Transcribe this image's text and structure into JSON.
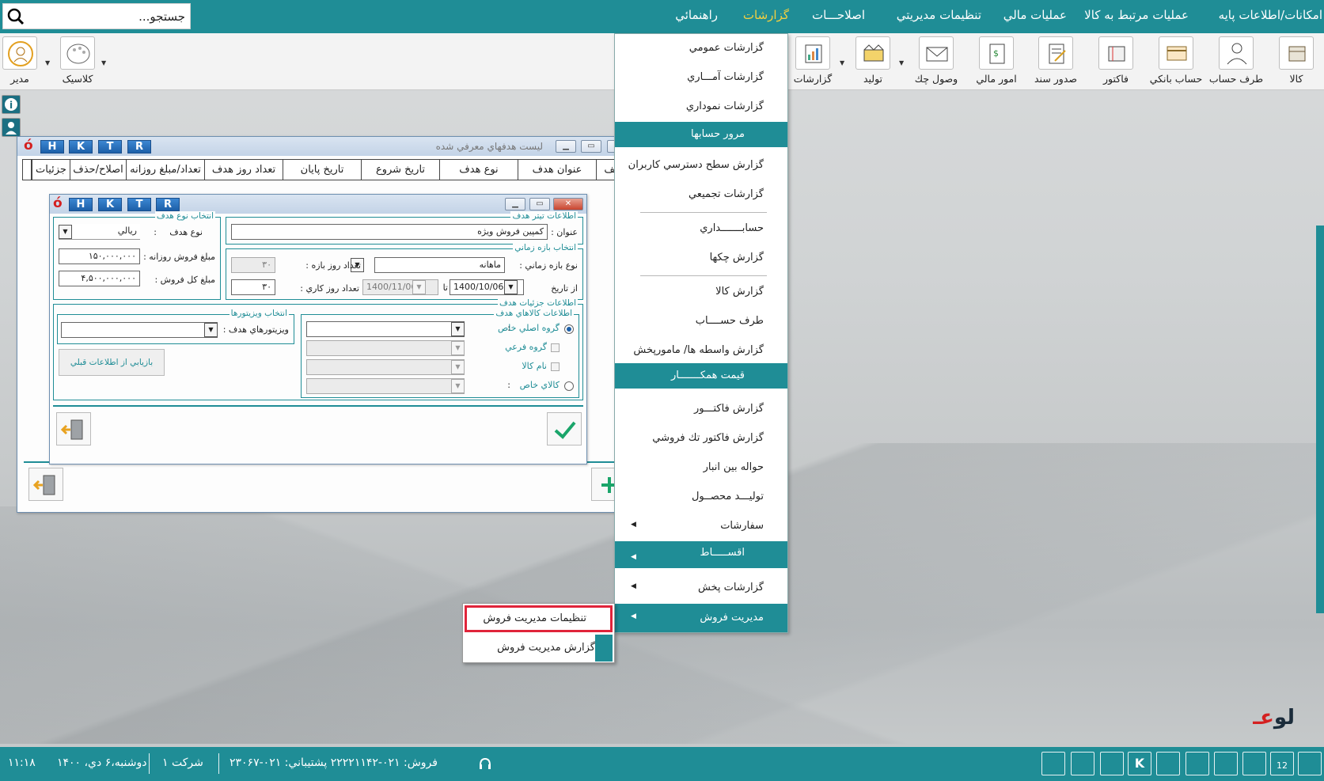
{
  "search": {
    "placeholder": "جستجو..."
  },
  "menubar": {
    "items": [
      "امکانات/اطلاعات پایه",
      "عملیات مرتبط به کالا",
      "عملیات مالي",
      "تنظيمات مديريتي",
      "اصلاحـــات",
      "گزارشات",
      "راهنمائي"
    ],
    "active": "گزارشات"
  },
  "toolbar": {
    "right": [
      "کالا",
      "طرف حساب",
      "حساب بانکي",
      "فاکتور",
      "صدور سند",
      "امور مالي",
      "وصول چك",
      "توليد",
      "گزارشات"
    ],
    "left": [
      "کلاسيک",
      "مدير"
    ]
  },
  "report_menu": {
    "items": [
      "گزارشات عمومي",
      "گزارشات آمـــاري",
      "گزارشات نموداري",
      "مرور حسابها",
      "گزارش سطح دسترسي کاربران",
      "گزارشات تجميعي",
      "حسابـــــــداري",
      "گزارش چکها",
      "گزارش کالا",
      "طرف حســــاب",
      "گزارش واسطه ها/ مامورپخش",
      "قيمت همکـــــــار",
      "گزارش فاکتـــور",
      "گزارش فاکتور تك فروشي",
      "حواله بين انبار",
      "توليـــد محصــول",
      "سفارشات",
      "اقســـــاط",
      "گزارشات پخش",
      "مديريت فروش"
    ]
  },
  "sub_menu": {
    "items": [
      "تنظيمات مديريت فروش",
      "گزارش مديريت فروش"
    ]
  },
  "list_window": {
    "title": "ليست هدفهاي معرفي شده",
    "letters": [
      "H",
      "K",
      "T",
      "R"
    ],
    "columns": [
      "رديف",
      "عنوان هدف",
      "نوع هدف",
      "تاريخ شروع",
      "تاريخ پايان",
      "تعداد روز هدف",
      "تعداد/مبلغ روزانه",
      "اصلاح/حذف",
      "جزئيات"
    ]
  },
  "form_window": {
    "letters": [
      "H",
      "K",
      "T",
      "R"
    ],
    "header_section": {
      "legend": "اطلاعات تيتر هدف",
      "title_label": "عنوان :",
      "title_value": "کمپين فروش ويژه"
    },
    "period_section": {
      "legend": "انتخاب بازه زماني",
      "type_label": "نوع بازه زماني :",
      "type_value": "ماهانه",
      "days_label": "تعداد روز بازه :",
      "days_value": "۳۰",
      "from_label": "از تاريخ",
      "from_value": "1400/10/06",
      "to_label": "تا",
      "to_value": "1400/11/06",
      "workdays_label": "تعداد روز کاري :",
      "workdays_value": "۳۰"
    },
    "goal_type_section": {
      "legend": "انتخاب نوع هدف",
      "type_label": "نوع هدف",
      "type_value": "ريالي",
      "daily_label": "مبلغ فروش روزانه :",
      "daily_value": "۱۵۰,۰۰۰,۰۰۰",
      "total_label": "مبلغ کل فروش :",
      "total_value": "۴,۵۰۰,۰۰۰,۰۰۰"
    },
    "details_section": {
      "legend": "اطلاعات جزئيات هدف",
      "goods_legend": "اطلاعات کالاهاي هدف",
      "options": [
        "گروه اصلي خاص",
        "گروه فرعي",
        "نام کالا",
        "کالاي خاص"
      ]
    },
    "visitor_section": {
      "legend": "انتخاب ويزيتورها",
      "label": "ويزيتورهاي هدف :",
      "restore_button": "بازيابي از اطلاعات قبلي"
    }
  },
  "statusbar": {
    "time": "۱۱:۱۸",
    "date": "دوشنبه،۶ دي، ۱۴۰۰",
    "company": "شرکت ۱",
    "contact": "فروش: ۰۲۱-۲۲۲۲۱۱۴۲  پشتيباني: ۰۲۱-۲۳۰۶۷"
  },
  "brand": {
    "name": "لو",
    "o": "عـ"
  },
  "colors": {
    "teal": "#1f8d96",
    "highlight": "#e0243a",
    "active_menu": "#f4d03f"
  }
}
